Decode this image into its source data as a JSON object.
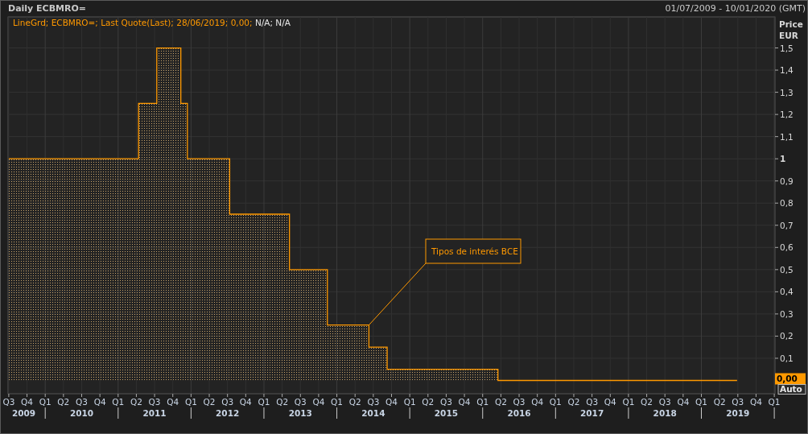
{
  "window": {
    "title": "Daily ECBMRO=",
    "date_range": "01/07/2009 - 10/01/2020 (GMT)"
  },
  "legend": {
    "prefix": "LineGrd;",
    "suffix": "; Last Quote(Last);  28/06/2019; 0,00;",
    "extra": "N/A; N/A"
  },
  "price_axis": {
    "title": [
      "Price",
      "EUR"
    ],
    "last_value": "0,00",
    "scale_mode": "Auto"
  },
  "x_axis_quarters": [
    "Q3",
    "Q4",
    "Q1",
    "Q2",
    "Q3",
    "Q4",
    "Q1",
    "Q2",
    "Q3",
    "Q4",
    "Q1",
    "Q2",
    "Q3",
    "Q4",
    "Q1",
    "Q2",
    "Q3",
    "Q4",
    "Q1",
    "Q2",
    "Q3",
    "Q4",
    "Q1",
    "Q2",
    "Q3",
    "Q4",
    "Q1",
    "Q2",
    "Q3",
    "Q4",
    "Q1",
    "Q2",
    "Q3",
    "Q4",
    "Q1",
    "Q2",
    "Q3",
    "Q4",
    "Q1",
    "Q2",
    "Q3",
    "Q4",
    "Q1"
  ],
  "chart_data": {
    "type": "area",
    "xlim": [
      2009.49,
      2020.01
    ],
    "ylim": [
      -0.06,
      1.64
    ],
    "x": [
      2009.5,
      2011.28,
      2011.53,
      2011.86,
      2011.95,
      2012.53,
      2013.35,
      2013.87,
      2014.44,
      2014.69,
      2016.21,
      2019.49
    ],
    "series": [
      {
        "name": "ECBMRO=",
        "color": "#ff9900",
        "values": [
          1,
          1.25,
          1.5,
          1.25,
          1,
          0.75,
          0.5,
          0.25,
          0.15,
          0.05,
          0,
          0
        ]
      }
    ],
    "yticks": [
      {
        "value": 0.1,
        "label": "0,1"
      },
      {
        "value": 0.2,
        "label": "0,2"
      },
      {
        "value": 0.3,
        "label": "0,3"
      },
      {
        "value": 0.4,
        "label": "0,4"
      },
      {
        "value": 0.5,
        "label": "0,5"
      },
      {
        "value": 0.6,
        "label": "0,6"
      },
      {
        "value": 0.7,
        "label": "0,7"
      },
      {
        "value": 0.8,
        "label": "0,8"
      },
      {
        "value": 0.9,
        "label": "0,9"
      },
      {
        "value": 1,
        "label": "1"
      },
      {
        "value": 1.1,
        "label": "1,1"
      },
      {
        "value": 1.2,
        "label": "1,2"
      },
      {
        "value": 1.3,
        "label": "1,3"
      },
      {
        "value": 1.4,
        "label": "1,4"
      },
      {
        "value": 1.5,
        "label": "1,5"
      }
    ],
    "grid": true,
    "xticks": [
      {
        "value": 2009.5,
        "label": "2009"
      },
      {
        "value": 2010.5,
        "label": "2010"
      },
      {
        "value": 2011.5,
        "label": "2011"
      },
      {
        "value": 2012.5,
        "label": "2012"
      },
      {
        "value": 2013.5,
        "label": "2013"
      },
      {
        "value": 2014.5,
        "label": "2014"
      },
      {
        "value": 2015.5,
        "label": "2015"
      },
      {
        "value": 2016.5,
        "label": "2016"
      },
      {
        "value": 2017.5,
        "label": "2017"
      },
      {
        "value": 2018.5,
        "label": "2018"
      },
      {
        "value": 2019.5,
        "label": "2019"
      }
    ],
    "annotations": [
      "Tipos de interés BCE"
    ]
  }
}
